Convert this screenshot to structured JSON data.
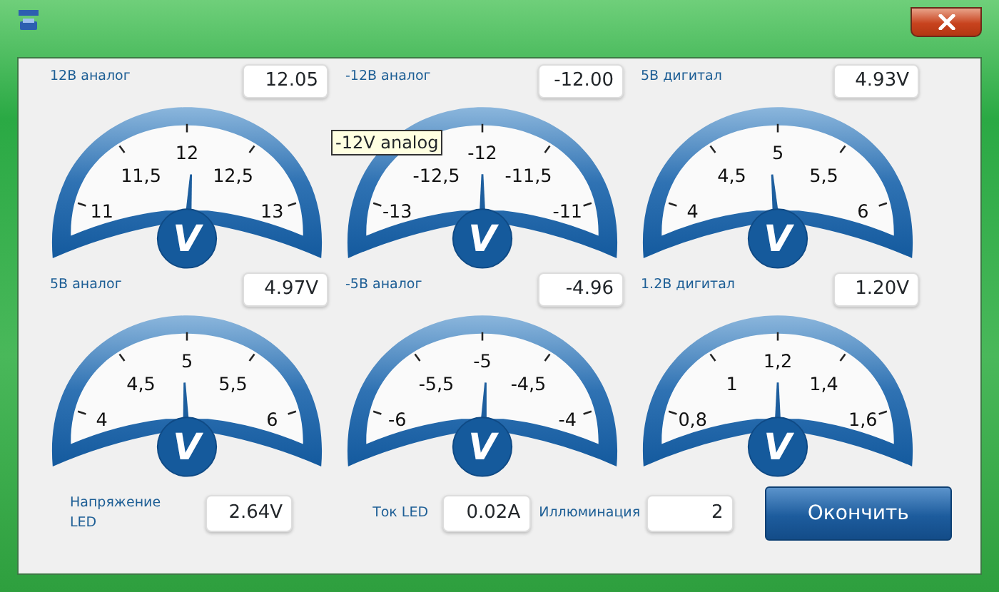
{
  "gauges": [
    {
      "label": "12В аналог",
      "value": "12.05",
      "hub": "V",
      "level": 0.525,
      "scale": [
        "11",
        "11,5",
        "12",
        "12,5",
        "13"
      ]
    },
    {
      "label": "-12В аналог",
      "value": "-12.00",
      "hub": "V",
      "level": 0.5,
      "scale": [
        "-13",
        "-12,5",
        "-12",
        "-11,5",
        "-11"
      ]
    },
    {
      "label": "5В дигитал",
      "value": "4.93V",
      "hub": "V",
      "level": 0.465,
      "scale": [
        "4",
        "4,5",
        "5",
        "5,5",
        "6"
      ]
    },
    {
      "label": "5В аналог",
      "value": "4.97V",
      "hub": "V",
      "level": 0.485,
      "scale": [
        "4",
        "4,5",
        "5",
        "5,5",
        "6"
      ]
    },
    {
      "label": "-5В аналог",
      "value": "-4.96",
      "hub": "V",
      "level": 0.52,
      "scale": [
        "-6",
        "-5,5",
        "-5",
        "-4,5",
        "-4"
      ]
    },
    {
      "label": "1.2В дигитал",
      "value": "1.20V",
      "hub": "V",
      "level": 0.5,
      "scale": [
        "0,8",
        "1",
        "1,2",
        "1,4",
        "1,6"
      ]
    }
  ],
  "tooltip": {
    "text": "-12V analog"
  },
  "readings": [
    {
      "label": "Напряжение LED",
      "value": "2.64V"
    },
    {
      "label": "Ток LED",
      "value": "0.02A"
    },
    {
      "label": "Иллюминация",
      "value": "2"
    }
  ],
  "finish_button": "Окончить"
}
